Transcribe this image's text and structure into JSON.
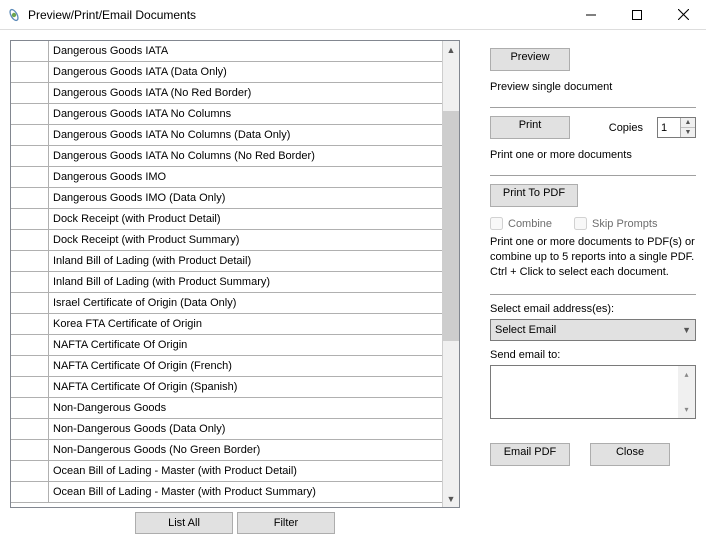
{
  "window": {
    "title": "Preview/Print/Email Documents"
  },
  "list": {
    "items": [
      "Dangerous Goods IATA",
      "Dangerous Goods IATA (Data Only)",
      "Dangerous Goods IATA (No Red Border)",
      "Dangerous Goods IATA No Columns",
      "Dangerous Goods IATA No Columns (Data Only)",
      "Dangerous Goods IATA No Columns (No Red Border)",
      "Dangerous Goods IMO",
      "Dangerous Goods IMO (Data Only)",
      "Dock Receipt (with Product Detail)",
      "Dock Receipt (with Product Summary)",
      "Inland Bill of Lading (with Product Detail)",
      "Inland Bill of Lading (with Product Summary)",
      "Israel Certificate of Origin (Data Only)",
      "Korea FTA Certificate of Origin",
      "NAFTA Certificate Of Origin",
      "NAFTA Certificate Of Origin (French)",
      "NAFTA Certificate Of Origin (Spanish)",
      "Non-Dangerous Goods",
      "Non-Dangerous Goods (Data Only)",
      "Non-Dangerous Goods (No Green Border)",
      "Ocean Bill of Lading - Master (with Product Detail)",
      "Ocean Bill of Lading - Master (with Product Summary)"
    ],
    "buttons": {
      "list_all": "List All",
      "filter": "Filter"
    }
  },
  "right": {
    "preview_btn": "Preview",
    "preview_desc": "Preview single document",
    "print_btn": "Print",
    "copies_label": "Copies",
    "copies_value": "1",
    "print_desc": "Print one or more documents",
    "pdf_btn": "Print To PDF",
    "combine": "Combine",
    "skip": "Skip Prompts",
    "pdf_help": "Print one or more documents to PDF(s) or combine up to 5 reports into a single PDF.  Ctrl + Click to select each document.",
    "select_email_label": "Select email address(es):",
    "select_email_value": "Select Email",
    "send_to_label": "Send email to:",
    "email_pdf_btn": "Email PDF",
    "close_btn": "Close"
  }
}
